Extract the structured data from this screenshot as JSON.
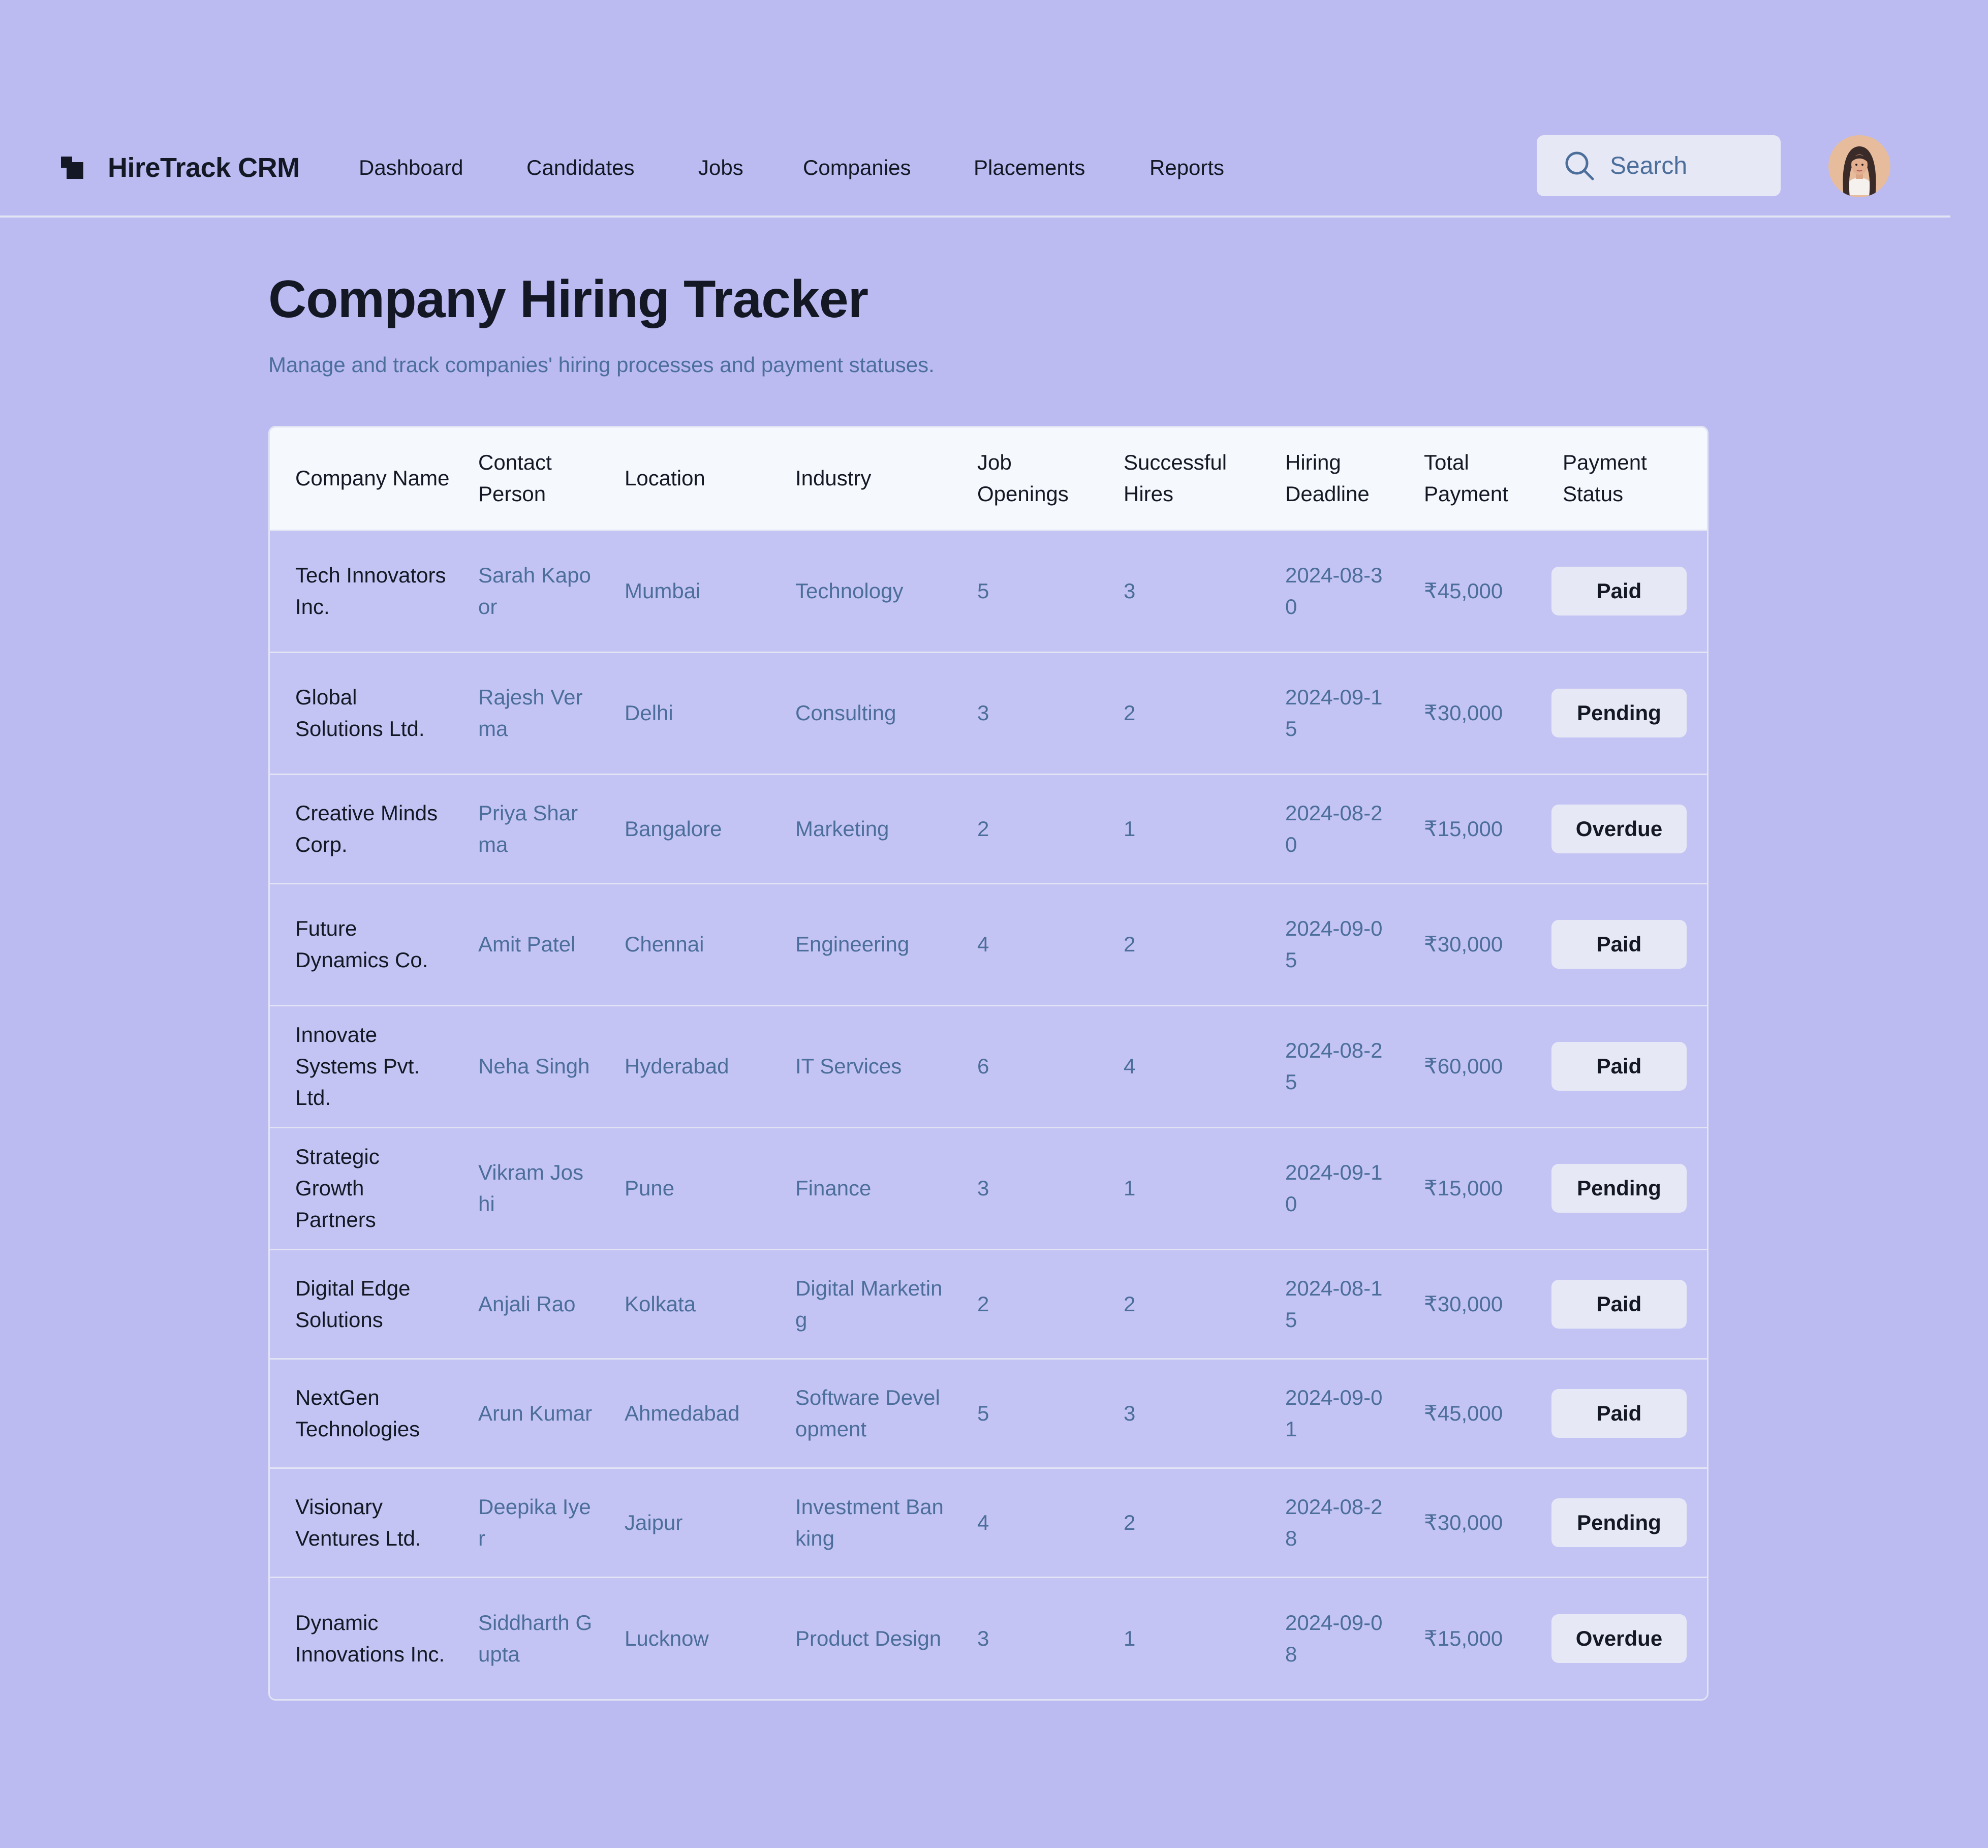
{
  "app": {
    "name": "HireTrack CRM"
  },
  "nav": {
    "items": [
      "Dashboard",
      "Candidates",
      "Jobs",
      "Companies",
      "Placements",
      "Reports"
    ]
  },
  "search": {
    "placeholder": "Search"
  },
  "page": {
    "title": "Company Hiring Tracker",
    "subtitle": "Manage and track companies' hiring processes and payment statuses."
  },
  "table": {
    "headers": [
      "Company Name",
      "Contact Person",
      "Location",
      "Industry",
      "Job Openings",
      "Successful Hires",
      "Hiring Deadline",
      "Total Payment",
      "Payment Status"
    ],
    "rows": [
      [
        "Tech Innovators Inc.",
        "Sarah Kapoor",
        "Mumbai",
        "Technology",
        "5",
        "3",
        "2024-08-30",
        "₹45,000",
        "Paid"
      ],
      [
        "Global Solutions Ltd.",
        "Rajesh Verma",
        "Delhi",
        "Consulting",
        "3",
        "2",
        "2024-09-15",
        "₹30,000",
        "Pending"
      ],
      [
        "Creative Minds Corp.",
        "Priya Sharma",
        "Bangalore",
        "Marketing",
        "2",
        "1",
        "2024-08-20",
        "₹15,000",
        "Overdue"
      ],
      [
        "Future Dynamics Co.",
        "Amit Patel",
        "Chennai",
        "Engineering",
        "4",
        "2",
        "2024-09-05",
        "₹30,000",
        "Paid"
      ],
      [
        "Innovate Systems Pvt. Ltd.",
        "Neha Singh",
        "Hyderabad",
        "IT Services",
        "6",
        "4",
        "2024-08-25",
        "₹60,000",
        "Paid"
      ],
      [
        "Strategic Growth Partners",
        "Vikram Joshi",
        "Pune",
        "Finance",
        "3",
        "1",
        "2024-09-10",
        "₹15,000",
        "Pending"
      ],
      [
        "Digital Edge Solutions",
        "Anjali Rao",
        "Kolkata",
        "Digital Marketing",
        "2",
        "2",
        "2024-08-15",
        "₹30,000",
        "Paid"
      ],
      [
        "NextGen Technologies",
        "Arun Kumar",
        "Ahmedabad",
        "Software Development",
        "5",
        "3",
        "2024-09-01",
        "₹45,000",
        "Paid"
      ],
      [
        "Visionary Ventures Ltd.",
        "Deepika Iyer",
        "Jaipur",
        "Investment Banking",
        "4",
        "2",
        "2024-08-28",
        "₹30,000",
        "Pending"
      ],
      [
        "Dynamic Innovations Inc.",
        "Siddharth Gupta",
        "Lucknow",
        "Product Design",
        "3",
        "1",
        "2024-09-08",
        "₹15,000",
        "Overdue"
      ]
    ]
  },
  "icons": {
    "logo": "hiretrack-logo-icon",
    "search": "search-icon",
    "avatar": "user-avatar"
  }
}
